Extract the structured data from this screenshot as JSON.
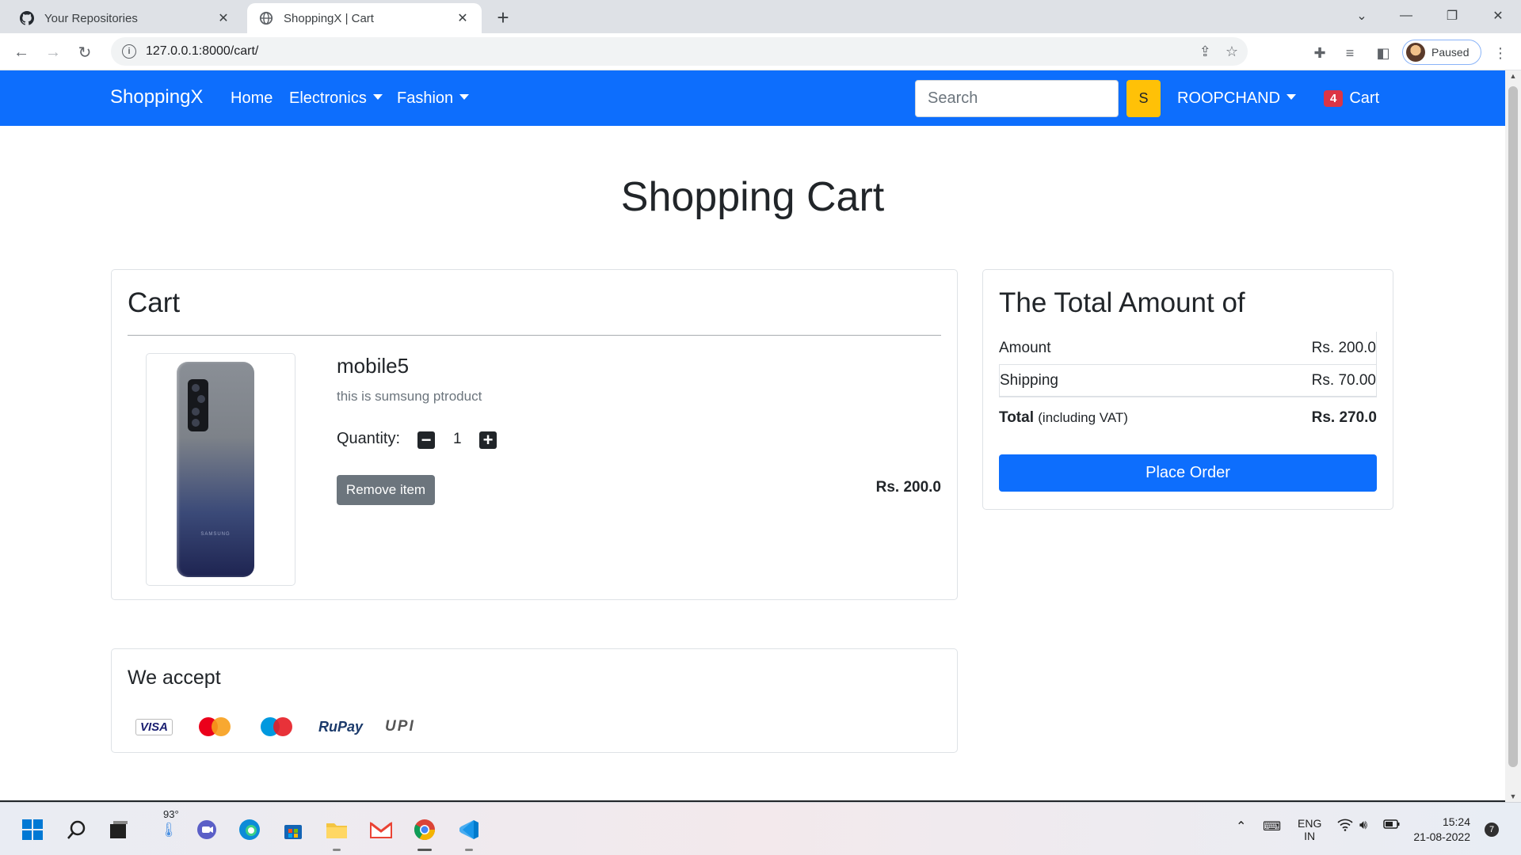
{
  "browser": {
    "tabs": [
      {
        "title": "Your Repositories",
        "icon": "github-icon",
        "active": false
      },
      {
        "title": "ShoppingX | Cart",
        "icon": "globe-icon",
        "active": true
      }
    ],
    "new_tab": "+",
    "url": "127.0.0.1:8000/cart/",
    "profile_label": "Paused"
  },
  "nav": {
    "brand": "ShoppingX",
    "links": [
      {
        "label": "Home",
        "dropdown": false
      },
      {
        "label": "Electronics",
        "dropdown": true
      },
      {
        "label": "Fashion",
        "dropdown": true
      }
    ],
    "search_placeholder": "Search",
    "search_button": "S",
    "user": "ROOPCHAND",
    "cart_count": "4",
    "cart_label": "Cart",
    "primary_color": "#0d6efd",
    "search_button_color": "#ffc107",
    "badge_color": "#dc3545"
  },
  "page": {
    "title": "Shopping Cart"
  },
  "cart": {
    "heading": "Cart",
    "items": [
      {
        "name": "mobile5",
        "description": "this is sumsung ptroduct",
        "quantity_label": "Quantity:",
        "quantity": "1",
        "remove_label": "Remove item",
        "price": "Rs. 200.0",
        "image_brand": "SAMSUNG"
      }
    ]
  },
  "summary": {
    "heading": "The Total Amount of",
    "rows": [
      {
        "label": "Amount",
        "value": "Rs. 200.0"
      },
      {
        "label": "Shipping",
        "value": "Rs. 70.00"
      }
    ],
    "total_label": "Total",
    "total_note": "(including VAT)",
    "total_value": "Rs. 270.0",
    "place_order": "Place Order"
  },
  "accept": {
    "heading": "We accept",
    "methods": [
      "VISA",
      "MasterCard",
      "Maestro",
      "RuPay",
      "UPI"
    ]
  },
  "taskbar": {
    "weather": "93°",
    "lang_top": "ENG",
    "lang_bottom": "IN",
    "time": "15:24",
    "date": "21-08-2022",
    "notifications": "7"
  }
}
